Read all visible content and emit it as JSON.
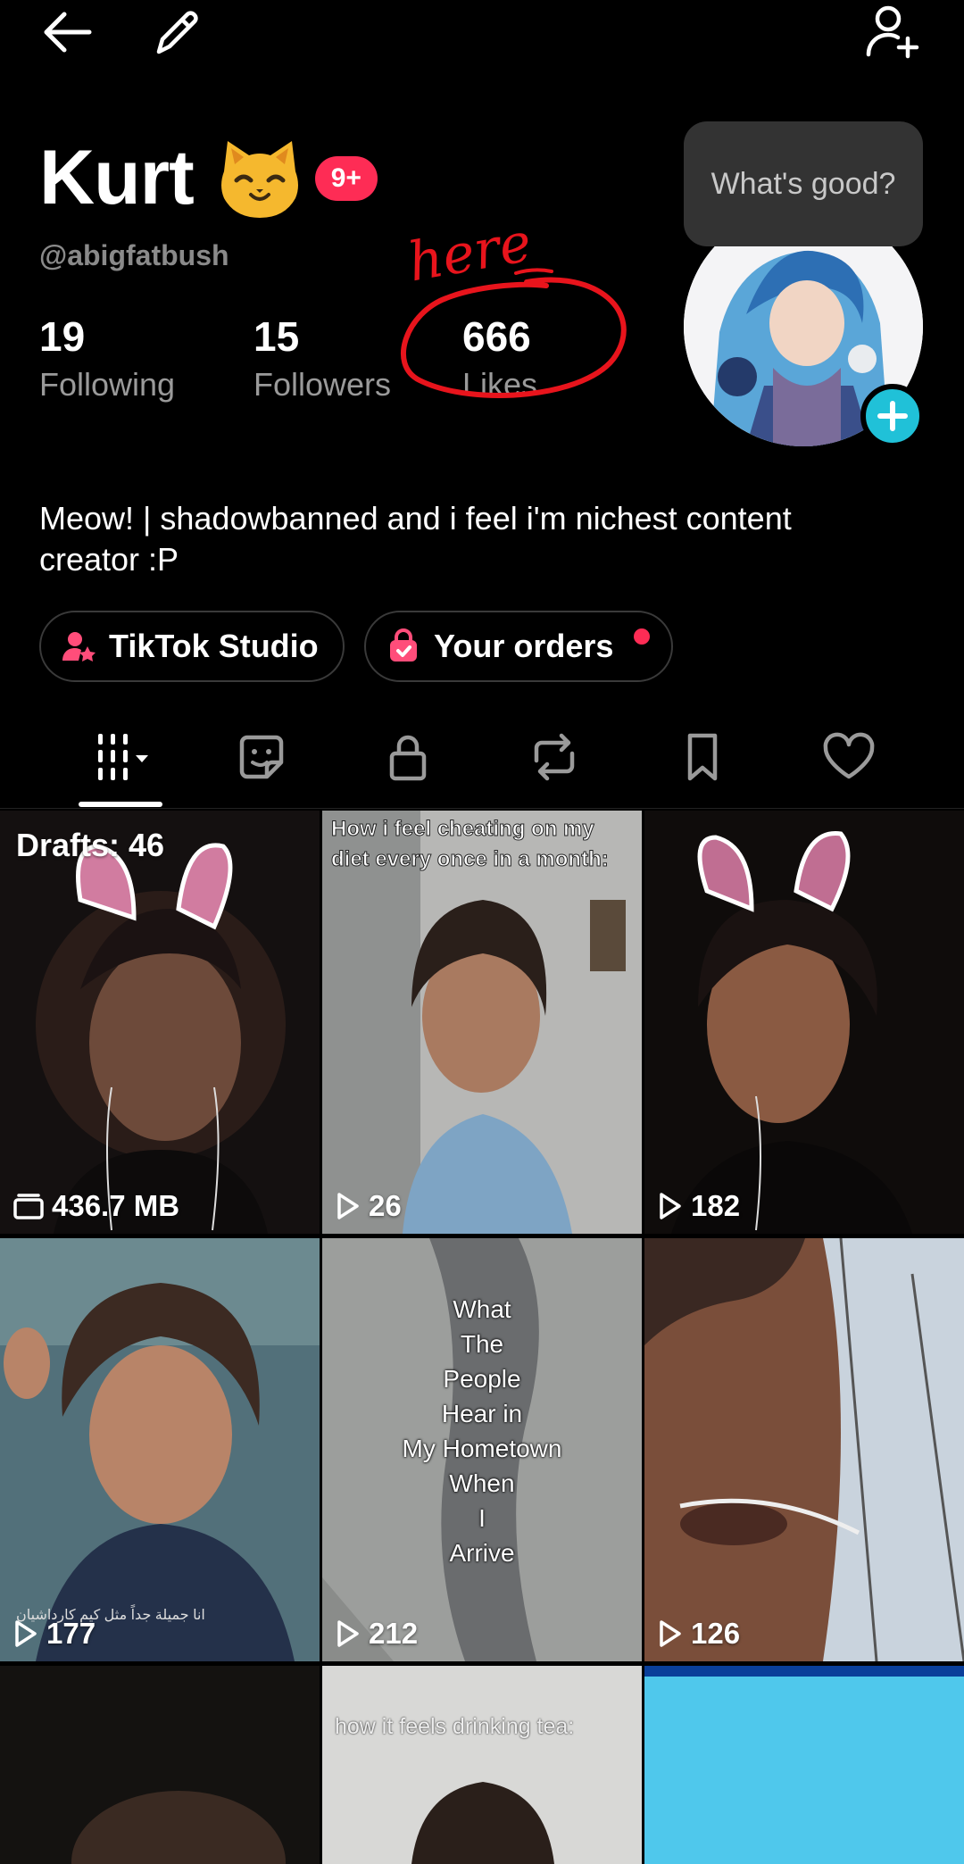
{
  "profile": {
    "name": "Kurt",
    "notification_badge": "9+",
    "handle": "@abigfatbush",
    "stats": {
      "following_count": "19",
      "following_label": "Following",
      "followers_count": "15",
      "followers_label": "Followers",
      "likes_count": "666",
      "likes_label": "Likes"
    },
    "status_bubble": "What's good?",
    "bio": "Meow! | shadowbanned and i feel i'm nichest content creator :P"
  },
  "annotation": {
    "text": "here",
    "color": "#e8141c"
  },
  "buttons": {
    "studio_label": "TikTok Studio",
    "orders_label": "Your orders"
  },
  "tabs": [
    "videos-icon",
    "sticker-icon",
    "lock-icon",
    "repost-icon",
    "bookmark-icon",
    "heart-icon"
  ],
  "grid": {
    "drafts_label": "Drafts: 46",
    "cells": [
      {
        "count": "436.7 MB",
        "count_icon": "drafts-stack-icon"
      },
      {
        "count": "26",
        "count_icon": "play-icon",
        "caption": "How i feel cheating on my diet every once in a month:"
      },
      {
        "count": "182",
        "count_icon": "play-icon"
      },
      {
        "count": "177",
        "count_icon": "play-icon",
        "caption": "انا جميلة جداً مثل كيم كارداشيان"
      },
      {
        "count": "212",
        "count_icon": "play-icon",
        "caption_lines": [
          "What",
          "The",
          "People",
          "Hear in",
          "My Hometown",
          "When",
          "I",
          "Arrive"
        ]
      },
      {
        "count": "126",
        "count_icon": "play-icon"
      },
      {},
      {
        "caption": "how it feels drinking tea:"
      },
      {}
    ]
  },
  "colors": {
    "background": "#000000",
    "accent_red": "#fe2c55",
    "accent_cyan": "#20c1d8",
    "muted_text": "#9a9a9a"
  }
}
